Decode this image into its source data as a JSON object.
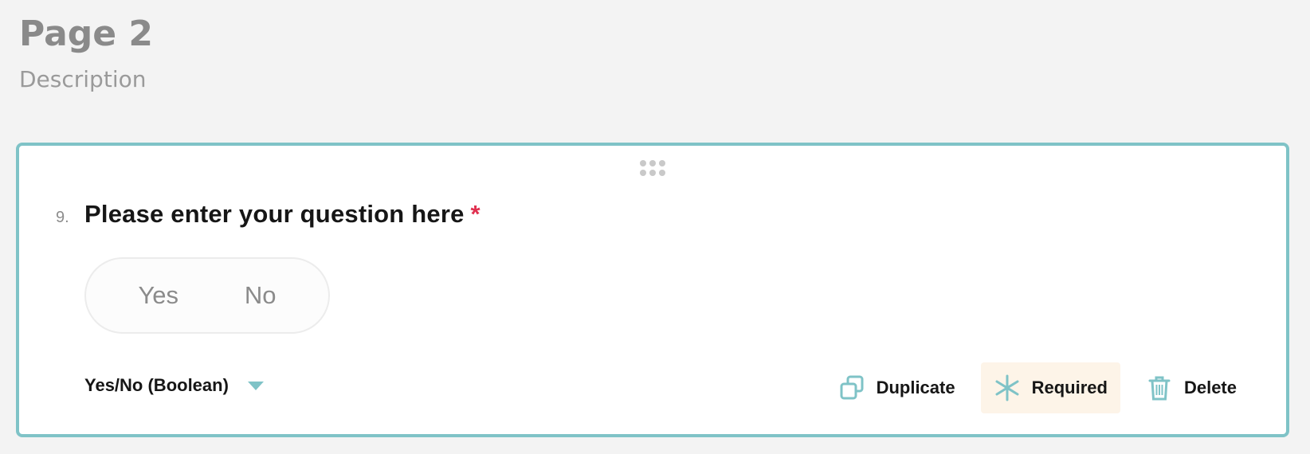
{
  "page": {
    "title": "Page 2",
    "description": "Description"
  },
  "question": {
    "number": "9.",
    "title": "Please enter your question here",
    "required_marker": "*",
    "options": {
      "yes": "Yes",
      "no": "No"
    },
    "type": "Yes/No (Boolean)"
  },
  "actions": {
    "duplicate": "Duplicate",
    "required": "Required",
    "delete": "Delete"
  },
  "icons": {
    "drag": "drag-handle-icon",
    "type_toggle": "chevron-down-icon",
    "duplicate": "copy-icon",
    "required": "asterisk-icon",
    "delete": "trash-icon"
  },
  "colors": {
    "accent": "#7fc3c7",
    "required_star": "#e0304f",
    "required_button_bg": "#fdf4e8",
    "background": "#f3f3f3"
  }
}
